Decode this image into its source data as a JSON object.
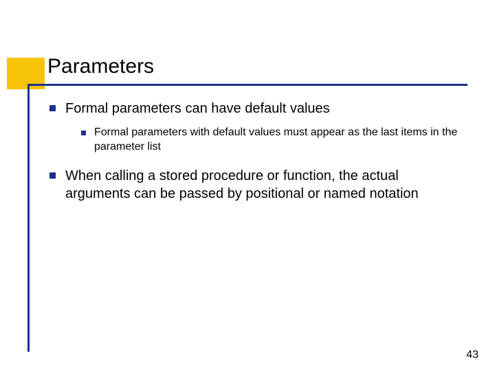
{
  "title": "Parameters",
  "bullets": {
    "item1": {
      "text": "Formal parameters can have default values",
      "sub": {
        "text": "Formal parameters with default values must appear as the last items in the parameter list"
      }
    },
    "item2": {
      "text": "When calling a stored procedure or function, the actual arguments can be passed by positional or named notation"
    }
  },
  "page_number": "43"
}
